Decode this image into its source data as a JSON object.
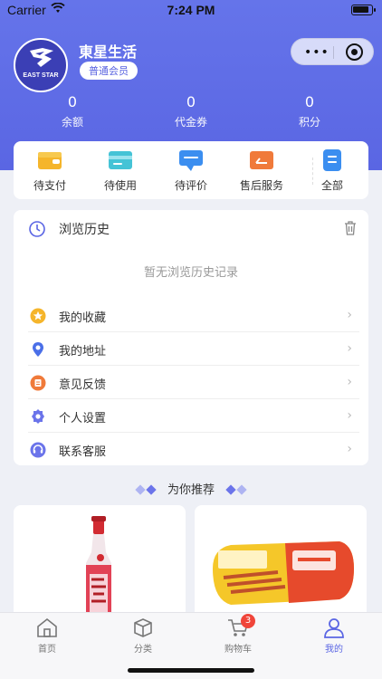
{
  "status": {
    "carrier": "Carrier",
    "time": "7:24 PM"
  },
  "profile": {
    "name": "東星生活",
    "level": "普通会员",
    "logo_text": "EAST STAR"
  },
  "capsule": {
    "more": "•••"
  },
  "stats": [
    {
      "value": "0",
      "label": "余额"
    },
    {
      "value": "0",
      "label": "代金券"
    },
    {
      "value": "0",
      "label": "积分"
    }
  ],
  "orders": [
    {
      "label": "待支付",
      "icon": "wallet-icon",
      "color": "#f5b52b"
    },
    {
      "label": "待使用",
      "icon": "card-icon",
      "color": "#45c3d6"
    },
    {
      "label": "待评价",
      "icon": "chat-icon",
      "color": "#3b8ef0"
    },
    {
      "label": "售后服务",
      "icon": "return-icon",
      "color": "#f07a3a"
    },
    {
      "label": "全部",
      "icon": "list-icon",
      "color": "#3b8ef0"
    }
  ],
  "history": {
    "title": "浏览历史",
    "empty": "暂无浏览历史记录"
  },
  "menu": [
    {
      "label": "我的收藏",
      "icon": "star-icon"
    },
    {
      "label": "我的地址",
      "icon": "location-icon"
    },
    {
      "label": "意见反馈",
      "icon": "feedback-icon"
    },
    {
      "label": "个人设置",
      "icon": "settings-icon"
    },
    {
      "label": "联系客服",
      "icon": "headset-icon"
    }
  ],
  "recommend": {
    "title": "为你推荐"
  },
  "tabs": [
    {
      "label": "首页",
      "icon": "home-icon"
    },
    {
      "label": "分类",
      "icon": "category-icon"
    },
    {
      "label": "购物车",
      "icon": "cart-icon",
      "badge": "3"
    },
    {
      "label": "我的",
      "icon": "user-icon",
      "active": true
    }
  ],
  "colors": {
    "brand": "#5b66e4",
    "badge": "#f0453a"
  }
}
